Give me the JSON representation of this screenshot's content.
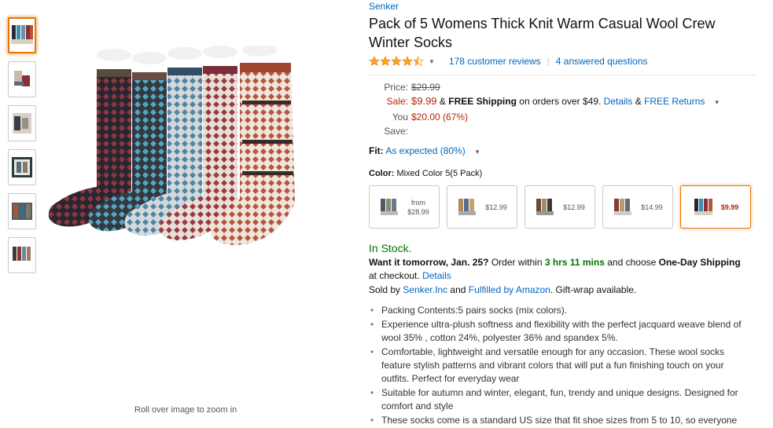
{
  "thumbnails": [
    {
      "name": "thumb-1",
      "active": true
    },
    {
      "name": "thumb-2",
      "active": false
    },
    {
      "name": "thumb-3",
      "active": false
    },
    {
      "name": "thumb-4",
      "active": false
    },
    {
      "name": "thumb-5",
      "active": false
    },
    {
      "name": "thumb-6",
      "active": false
    }
  ],
  "image": {
    "zoom_hint": "Roll over image to zoom in"
  },
  "product": {
    "brand": "Senker",
    "title": "Pack of 5 Womens Thick Knit Warm Casual Wool Crew Winter Socks",
    "rating": 4.5,
    "reviews_label": "178 customer reviews",
    "questions_label": "4 answered questions"
  },
  "price": {
    "list_label": "Price:",
    "list_value": "$29.99",
    "sale_label": "Sale:",
    "sale_value": "$9.99",
    "amp1": "&",
    "free_shipping": "FREE Shipping",
    "shipping_text": "on orders over $49.",
    "details": "Details",
    "amp2": "&",
    "free_returns": "FREE Returns",
    "save_label": "You Save:",
    "save_value": "$20.00 (67%)"
  },
  "fit": {
    "label": "Fit:",
    "value": "As expected (80%)"
  },
  "color": {
    "label": "Color:",
    "value": "Mixed Color 5(5 Pack)",
    "swatches": [
      {
        "line1": "from",
        "line2": "$28.99",
        "selected": false
      },
      {
        "line1": "$12.99",
        "line2": "",
        "selected": false
      },
      {
        "line1": "$12.99",
        "line2": "",
        "selected": false
      },
      {
        "line1": "$14.99",
        "line2": "",
        "selected": false
      },
      {
        "line1": "$9.99",
        "line2": "",
        "selected": true
      }
    ]
  },
  "availability": {
    "status": "In Stock.",
    "want_it": "Want it tomorrow, Jan. 25?",
    "order_within": "Order within",
    "time": "3 hrs 11 mins",
    "and_choose": "and choose",
    "one_day": "One-Day Shipping",
    "at_checkout": "at checkout.",
    "details": "Details",
    "sold_by": "Sold by",
    "seller": "Senker.Inc",
    "and": "and",
    "fulfilled": "Fulfilled by Amazon",
    "gift": ". Gift-wrap available."
  },
  "bullets": [
    "Packing Contents:5 pairs socks (mix colors).",
    "Experience ultra-plush softness and flexibility with the perfect jacquard weave blend of wool 35% , cotton 24%, polyester 36% and spandex 5%.",
    "Comfortable, lightweight and versatile enough for any occasion. These wool socks feature stylish patterns and vibrant colors that will put a fun finishing touch on your outfits. Perfect for everyday wear",
    "Suitable for autumn and winter, elegant, fun, trendy and unique designs. Designed for comfort and style",
    "These socks come is a standard US size that fit shoe sizes from 5 to 10, so everyone can enjoy warm, toasty feet."
  ],
  "colors": {
    "link": "#0066c0",
    "sale": "#b12704",
    "in_stock": "#007600",
    "star": "#ffa41c",
    "selected_border": "#e77600"
  }
}
